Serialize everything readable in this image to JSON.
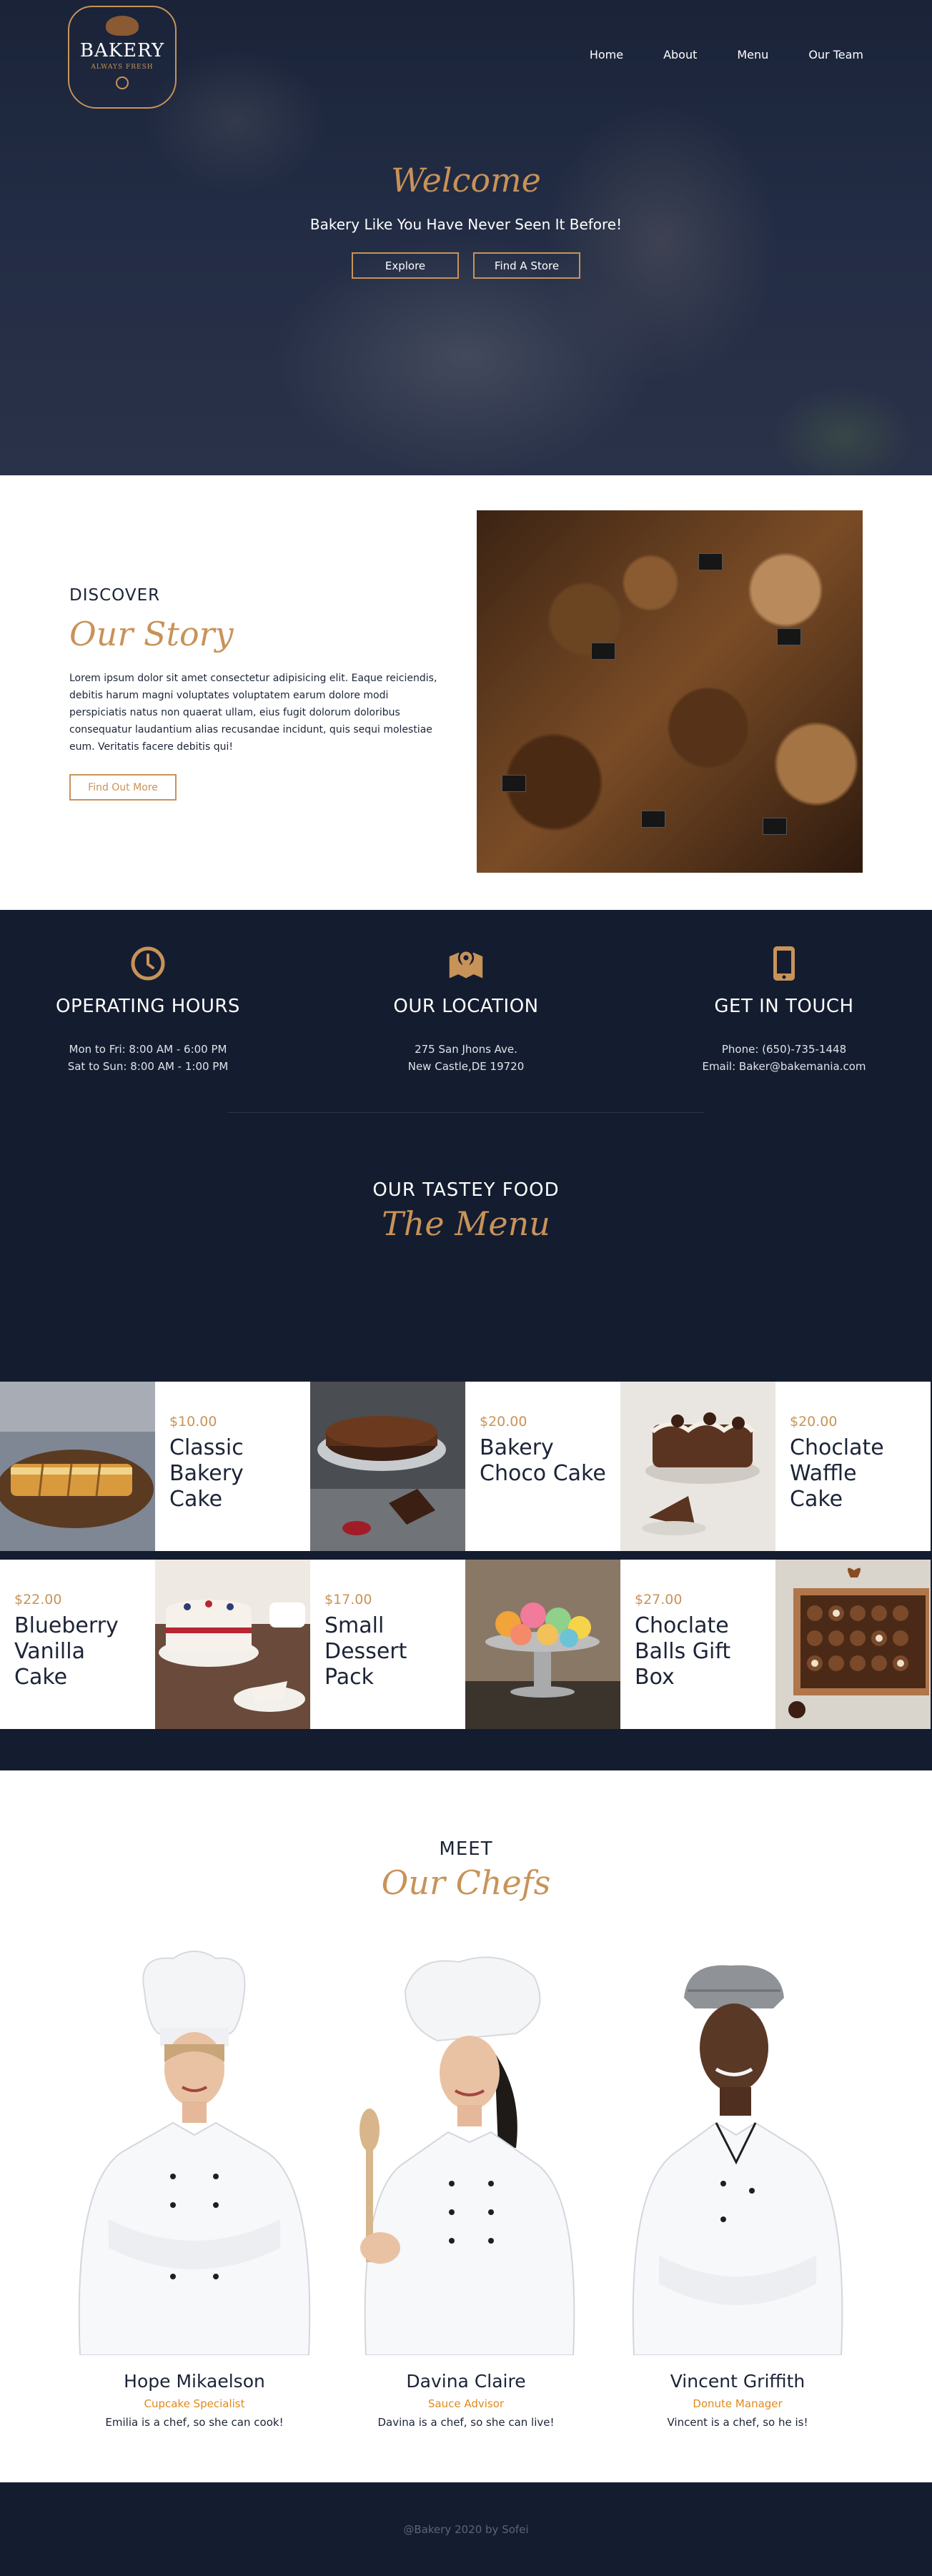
{
  "header": {
    "logo": {
      "brand": "BAKERY",
      "tagline": "ALWAYS FRESH"
    },
    "nav": [
      "Home",
      "About",
      "Menu",
      "Our Team"
    ]
  },
  "hero": {
    "title": "Welcome",
    "subtitle": "Bakery Like You Have Never Seen It Before!",
    "buttons": [
      "Explore",
      "Find A Store"
    ]
  },
  "story": {
    "eyebrow": "DISCOVER",
    "title": "Our Story",
    "body": "Lorem ipsum dolor sit amet consectetur adipisicing elit. Eaque reiciendis, debitis harum magni voluptates voluptatem earum dolore modi perspiciatis natus non quaerat ullam, eius fugit dolorum doloribus consequatur laudantium alias recusandae incidunt, quis sequi molestiae eum. Veritatis facere debitis qui!",
    "button": "Find Out More"
  },
  "info": [
    {
      "icon": "clock-icon",
      "heading": "OPERATING HOURS",
      "lines": [
        "Mon to Fri: 8:00 AM - 6:00 PM",
        "Sat to Sun: 8:00 AM - 1:00 PM"
      ]
    },
    {
      "icon": "map-pin-icon",
      "heading": "OUR LOCATION",
      "lines": [
        "275 San Jhons Ave.",
        "New Castle,DE 19720"
      ]
    },
    {
      "icon": "phone-icon",
      "heading": "GET IN TOUCH",
      "lines": [
        "Phone: (650)-735-1448",
        "Email: Baker@bakemania.com"
      ]
    }
  ],
  "menu": {
    "eyebrow": "OUR TASTEY FOOD",
    "title": "The Menu",
    "items": [
      {
        "price": "$10.00",
        "name": "Classic Bakery Cake"
      },
      {
        "price": "$20.00",
        "name": "Bakery Choco Cake"
      },
      {
        "price": "$20.00",
        "name": "Choclate Waffle Cake"
      },
      {
        "price": "$22.00",
        "name": "Blueberry Vanilla Cake"
      },
      {
        "price": "$17.00",
        "name": "Small Dessert Pack"
      },
      {
        "price": "$27.00",
        "name": "Choclate Balls Gift Box"
      }
    ]
  },
  "chefs": {
    "eyebrow": "MEET",
    "title": "Our Chefs",
    "people": [
      {
        "name": "Hope Mikaelson",
        "role": "Cupcake Specialist",
        "bio": "Emilia is a chef, so she can cook!"
      },
      {
        "name": "Davina Claire",
        "role": "Sauce Advisor",
        "bio": "Davina is a chef, so she can live!"
      },
      {
        "name": "Vincent Griffith",
        "role": "Donute Manager",
        "bio": "Vincent is a chef, so he is!"
      }
    ]
  },
  "footer": {
    "text": "@Bakery 2020 by Sofei"
  },
  "colors": {
    "accent": "#c89358",
    "navy": "#141c2f",
    "role": "#e08a1e"
  }
}
